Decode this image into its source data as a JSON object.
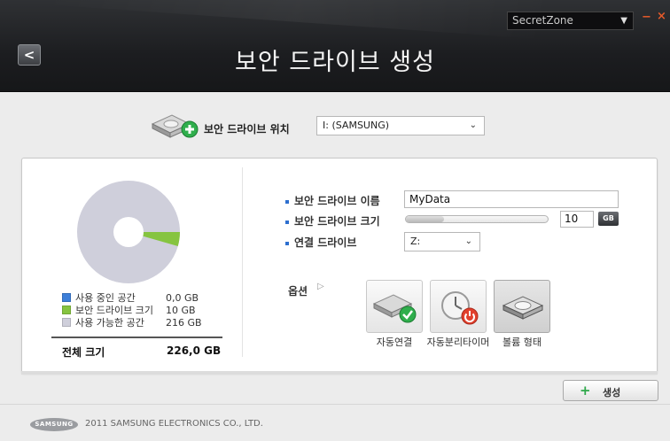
{
  "header": {
    "title": "보안 드라이브 생성",
    "app_select": "SecretZone",
    "back_symbol": "<",
    "minimize_symbol": "−",
    "close_symbol": "×"
  },
  "location": {
    "label": "보안 드라이브 위치",
    "value": "I: (SAMSUNG)"
  },
  "legend": {
    "used_label": "사용 중인 공간",
    "used_value": "0,0 GB",
    "used_color": "#3d7fd9",
    "secure_label": "보안 드라이브 크기",
    "secure_value": "10 GB",
    "secure_color": "#86c440",
    "free_label": "사용 가능한 공간",
    "free_value": "216 GB",
    "free_color": "#cfcfdb",
    "total_label": "전체 크기",
    "total_value": "226,0 GB"
  },
  "form": {
    "name_label": "보안 드라이브 이름",
    "name_value": "MyData",
    "size_label": "보안 드라이브 크기",
    "size_value": "10",
    "size_unit": "GB",
    "size_fraction": 0.045,
    "connect_label": "연결 드라이브",
    "connect_value": "Z:"
  },
  "options": {
    "label": "옵션",
    "items": [
      {
        "label": "자동연결",
        "selected": false
      },
      {
        "label": "자동분리타이머",
        "selected": false
      },
      {
        "label": "볼륨 형태",
        "selected": true
      }
    ]
  },
  "create_button": "생성",
  "footer": {
    "logo": "SAMSUNG",
    "copyright": "2011 SAMSUNG ELECTRONICS CO., LTD."
  }
}
